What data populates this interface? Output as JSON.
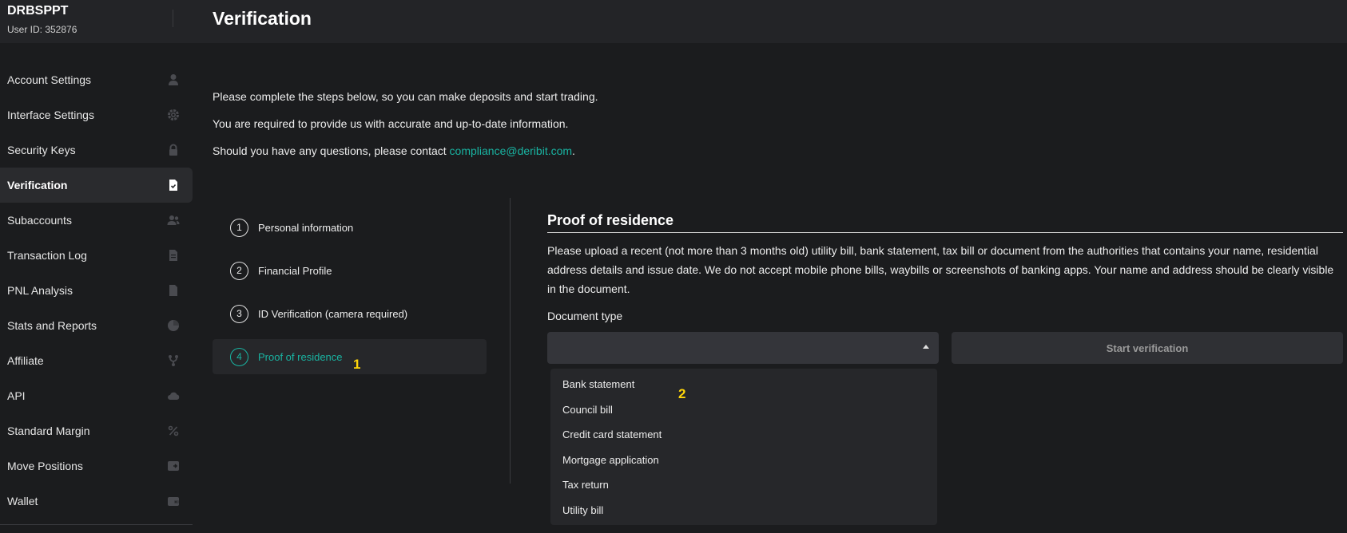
{
  "header": {
    "username": "DRBSPPT",
    "user_id": "User ID: 352876",
    "title": "Verification"
  },
  "sidebar": {
    "items": [
      {
        "label": "Account Settings",
        "icon": "user-icon"
      },
      {
        "label": "Interface Settings",
        "icon": "gear-icon"
      },
      {
        "label": "Security Keys",
        "icon": "lock-icon"
      },
      {
        "label": "Verification",
        "icon": "document-check-icon",
        "active": true
      },
      {
        "label": "Subaccounts",
        "icon": "users-icon"
      },
      {
        "label": "Transaction Log",
        "icon": "document-icon"
      },
      {
        "label": "PNL Analysis",
        "icon": "document-icon"
      },
      {
        "label": "Stats and Reports",
        "icon": "pie-chart-icon"
      },
      {
        "label": "Affiliate",
        "icon": "fork-icon"
      },
      {
        "label": "API",
        "icon": "cloud-icon"
      },
      {
        "label": "Standard Margin",
        "icon": "percent-icon"
      },
      {
        "label": "Move Positions",
        "icon": "move-icon"
      },
      {
        "label": "Wallet",
        "icon": "wallet-icon"
      }
    ]
  },
  "intro": {
    "line1": "Please complete the steps below, so you can make deposits and start trading.",
    "line2": "You are required to provide us with accurate and up-to-date information.",
    "line3_prefix": "Should you have any questions, please contact ",
    "email": "compliance@deribit.com",
    "line3_suffix": "."
  },
  "steps": [
    {
      "number": "1",
      "label": "Personal information"
    },
    {
      "number": "2",
      "label": "Financial Profile"
    },
    {
      "number": "3",
      "label": "ID Verification (camera required)"
    },
    {
      "number": "4",
      "label": "Proof of residence",
      "active": true
    }
  ],
  "annotations": {
    "a1": "1",
    "a2": "2"
  },
  "proof": {
    "title": "Proof of residence",
    "description": "Please upload a recent (not more than 3 months old) utility bill, bank statement, tax bill or document from the authorities that contains your name, residential address details and issue date. We do not accept mobile phone bills, waybills or screenshots of banking apps. Your name and address should be clearly visible in the document.",
    "doc_type_label": "Document type",
    "select_value": "",
    "start_button": "Start verification",
    "options": [
      "Bank statement",
      "Council bill",
      "Credit card statement",
      "Mortgage application",
      "Tax return",
      "Utility bill"
    ]
  },
  "colors": {
    "accent": "#19b4a2",
    "annotation": "#ffd60a"
  }
}
